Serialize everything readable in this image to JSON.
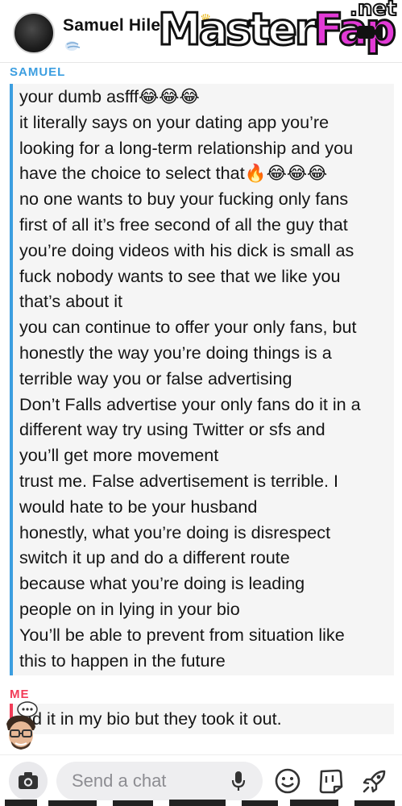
{
  "header": {
    "contact_name": "Samuel Hile",
    "avatar_icon": "avatar-icon",
    "status_icon": "wind-emoji-icon",
    "watermark": {
      "master": "Master",
      "fap": "Fap",
      "net": ".net"
    }
  },
  "conversation": {
    "samuel_label": "SAMUEL",
    "samuel_lines": [
      "your dumb asfff😂😂😂",
      "it literally says on your dating app you’re",
      "looking for a long-term relationship and you",
      "have the choice to select that🔥😂😂😂",
      "no one wants to buy your fucking only fans",
      "first of all it’s free second of all the guy that",
      "you’re doing videos with his dick is small as",
      "fuck nobody wants to see that we like you",
      "that’s about it",
      "you can continue to offer your only fans, but",
      "honestly the way you’re doing things is a",
      "terrible way you or false advertising",
      "Don’t Falls advertise your only fans do it in a",
      "different way try using Twitter or sfs  and",
      "you’ll get more movement",
      "trust me. False advertisement is terrible. I",
      "would hate to be your husband",
      "honestly, what you’re doing is disrespect",
      "switch it up and do a different route",
      "because what you’re doing is leading",
      "people on in lying in your bio",
      "You’ll be able to prevent from situation like",
      "this to happen in the future"
    ],
    "me_label": "ME",
    "me_message": "ad it in my bio but they took it out."
  },
  "composer": {
    "placeholder": "Send a chat",
    "icons": [
      "camera-icon",
      "microphone-icon",
      "smiley-icon",
      "sticker-icon",
      "rocket-icon"
    ]
  },
  "colors": {
    "samuel_accent": "#3c9ee0",
    "me_accent": "#f23c57",
    "watermark_accent": "#e23ad6"
  }
}
